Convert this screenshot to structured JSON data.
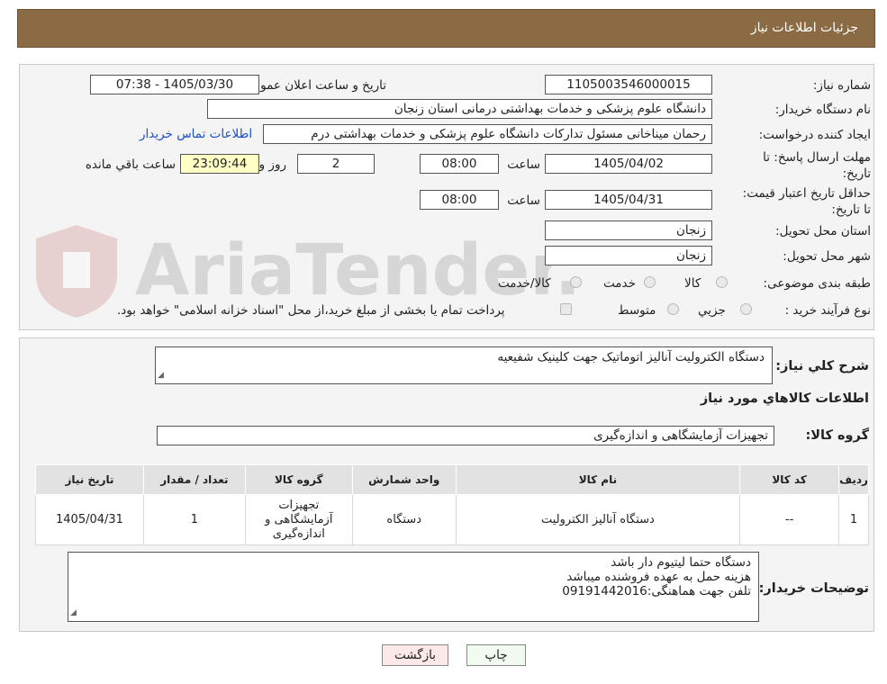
{
  "header": {
    "title": "جزئیات اطلاعات نیاز"
  },
  "need_number": {
    "label": "شماره نیاز:",
    "value": "1105003546000015"
  },
  "announce": {
    "label": "تاریخ و ساعت اعلان عمومي:",
    "value": "1405/03/30 - 07:38"
  },
  "buyer_org": {
    "label": "نام دستگاه خريدار:",
    "value": "دانشگاه علوم پزشکی و خدمات بهداشتی  درمانی استان زنجان"
  },
  "requester": {
    "label": "ایجاد کننده درخواست:",
    "value": "رحمان میناخانی مسئول تدارکات دانشگاه علوم پزشکی و خدمات بهداشتی  درم",
    "contact_link": "اطلاعات تماس خریدار"
  },
  "deadline": {
    "label": "مهلت ارسال پاسخ: تا تاریخ:",
    "date": "1405/04/02",
    "time_label": "ساعت",
    "time": "08:00",
    "days": "2",
    "days_label": "روز و",
    "remaining": "23:09:44",
    "remaining_label": "ساعت باقي مانده"
  },
  "validity": {
    "label": "حداقل تاریخ اعتبار قیمت: تا تاریخ:",
    "date": "1405/04/31",
    "time_label": "ساعت",
    "time": "08:00"
  },
  "province": {
    "label": "استان محل تحویل:",
    "value": "زنجان"
  },
  "city": {
    "label": "شهر محل تحویل:",
    "value": "زنجان"
  },
  "category": {
    "label": "طبقه بندی موضوعی:",
    "options": [
      "کالا",
      "خدمت",
      "کالا/خدمت"
    ]
  },
  "purchase_type": {
    "label": "نوع فرآیند خرید :",
    "options": [
      "جزیي",
      "متوسط"
    ],
    "note": "پرداخت تمام یا بخشی از مبلغ خرید،از محل \"اسناد خزانه اسلامی\" خواهد بود."
  },
  "summary": {
    "label": "شرح کلي نياز:",
    "value": "دستگاه الکترولیت آنالیز اتوماتیک جهت کلینیک شفیعیه"
  },
  "items_title": "اطلاعات کالاهاي مورد نياز",
  "goods_group": {
    "label": "گروه کالا:",
    "value": "تجهیزات آزمایشگاهی و اندازه‌گیری"
  },
  "table": {
    "headers": [
      "ردیف",
      "کد کالا",
      "نام کالا",
      "واحد شمارش",
      "گروه کالا",
      "تعداد / مقدار",
      "تاریخ نیاز"
    ],
    "rows": [
      [
        "1",
        "--",
        "دستگاه آنالیز الکترولیت",
        "دستگاه",
        "تجهیزات آزمایشگاهی و اندازه‌گیری",
        "1",
        "1405/04/31"
      ]
    ]
  },
  "notes": {
    "label": "توضیحات خریدار:",
    "lines": [
      "دستگاه حتما لیتیوم دار باشد",
      "هزینه حمل به عهده فروشنده میباشد",
      "تلفن جهت هماهنگی:09191442016"
    ]
  },
  "buttons": {
    "print": "چاپ",
    "back": "بازگشت"
  },
  "watermark": {
    "text": "AriaTender.neT"
  }
}
